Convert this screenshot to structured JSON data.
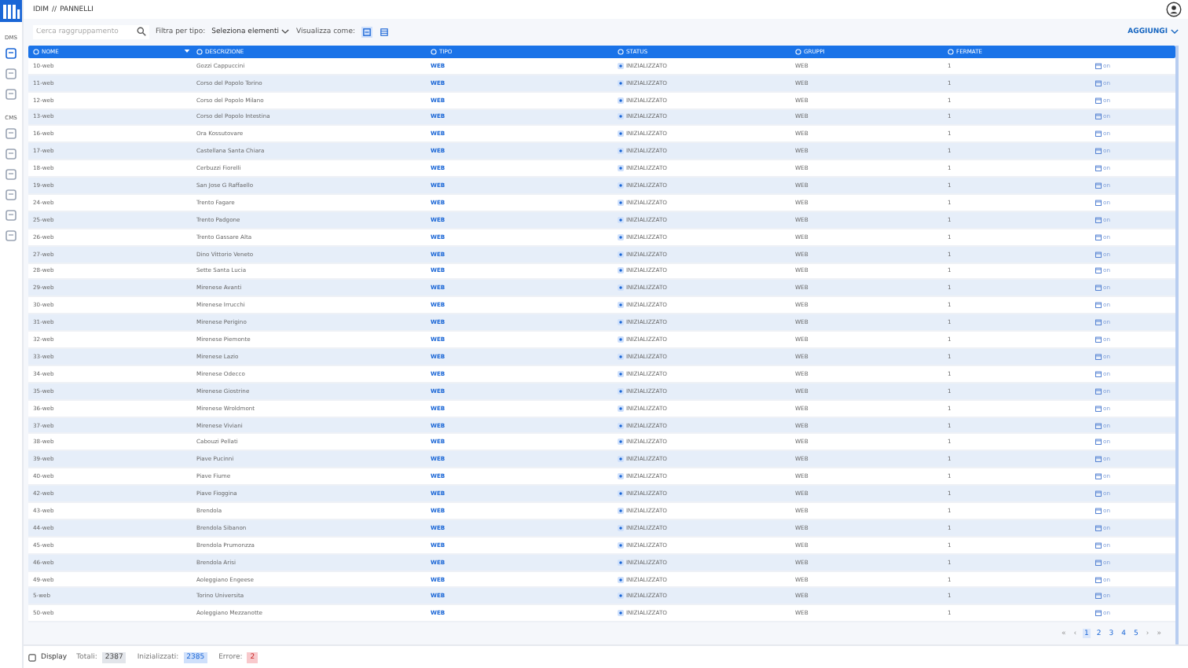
{
  "breadcrumb": [
    "IDIM",
    "//",
    "PANNELLI"
  ],
  "sidebar": {
    "sections": [
      {
        "label": "DMS",
        "items": [
          {
            "selected": true
          },
          {
            "selected": false
          },
          {
            "selected": false
          }
        ]
      },
      {
        "label": "CMS",
        "items": [
          {
            "selected": false
          },
          {
            "selected": false
          },
          {
            "selected": false
          },
          {
            "selected": false
          },
          {
            "selected": false
          },
          {
            "selected": false
          }
        ]
      }
    ]
  },
  "toolbar": {
    "search": {
      "placeholder": "Cerca raggruppamento"
    },
    "filter_label": "Filtra per tipo:",
    "filter_value": "Seleziona elementi",
    "view_label": "Visualizza come:",
    "views": [
      {
        "kind": "grid",
        "selected": true
      },
      {
        "kind": "list",
        "selected": false
      }
    ],
    "add_button": "AGGIUNGI"
  },
  "table": {
    "columns": [
      "NOME",
      "DESCRIZIONE",
      "TIPO",
      "STATUS",
      "GRUPPI",
      "FERMATE"
    ],
    "rows": [
      [
        "10-web",
        "Gozzi Cappuccini",
        "WEB",
        "INIZIALIZZATO",
        "WEB",
        "1",
        "on"
      ],
      [
        "11-web",
        "Corso del Popolo Torino",
        "WEB",
        "INIZIALIZZATO",
        "WEB",
        "1",
        "on"
      ],
      [
        "12-web",
        "Corso del Popolo Milano",
        "WEB",
        "INIZIALIZZATO",
        "WEB",
        "1",
        "on"
      ],
      [
        "13-web",
        "Corso del Popolo Intestina",
        "WEB",
        "INIZIALIZZATO",
        "WEB",
        "1",
        "on"
      ],
      [
        "16-web",
        "Ora Kossutovare",
        "WEB",
        "INIZIALIZZATO",
        "WEB",
        "1",
        "on"
      ],
      [
        "17-web",
        "Castellana Santa Chiara",
        "WEB",
        "INIZIALIZZATO",
        "WEB",
        "1",
        "on"
      ],
      [
        "18-web",
        "Cerbuzzi Fiorelli",
        "WEB",
        "INIZIALIZZATO",
        "WEB",
        "1",
        "on"
      ],
      [
        "19-web",
        "San Jose G Raffaello",
        "WEB",
        "INIZIALIZZATO",
        "WEB",
        "1",
        "on"
      ],
      [
        "24-web",
        "Trento Fagare",
        "WEB",
        "INIZIALIZZATO",
        "WEB",
        "1",
        "on"
      ],
      [
        "25-web",
        "Trento Padgone",
        "WEB",
        "INIZIALIZZATO",
        "WEB",
        "1",
        "on"
      ],
      [
        "26-web",
        "Trento Gassare Alta",
        "WEB",
        "INIZIALIZZATO",
        "WEB",
        "1",
        "on"
      ],
      [
        "27-web",
        "Dino Vittorio Veneto",
        "WEB",
        "INIZIALIZZATO",
        "WEB",
        "1",
        "on"
      ],
      [
        "28-web",
        "Sette Santa Lucia",
        "WEB",
        "INIZIALIZZATO",
        "WEB",
        "1",
        "on"
      ],
      [
        "29-web",
        "Mirenese Avanti",
        "WEB",
        "INIZIALIZZATO",
        "WEB",
        "1",
        "on"
      ],
      [
        "30-web",
        "Mirenese Irrucchi",
        "WEB",
        "INIZIALIZZATO",
        "WEB",
        "1",
        "on"
      ],
      [
        "31-web",
        "Mirenese Perigino",
        "WEB",
        "INIZIALIZZATO",
        "WEB",
        "1",
        "on"
      ],
      [
        "32-web",
        "Mirenese Piemonte",
        "WEB",
        "INIZIALIZZATO",
        "WEB",
        "1",
        "on"
      ],
      [
        "33-web",
        "Mirenese Lazio",
        "WEB",
        "INIZIALIZZATO",
        "WEB",
        "1",
        "on"
      ],
      [
        "34-web",
        "Mirenese Odecco",
        "WEB",
        "INIZIALIZZATO",
        "WEB",
        "1",
        "on"
      ],
      [
        "35-web",
        "Mirenese Giostrine",
        "WEB",
        "INIZIALIZZATO",
        "WEB",
        "1",
        "on"
      ],
      [
        "36-web",
        "Mirenese Wroldmont",
        "WEB",
        "INIZIALIZZATO",
        "WEB",
        "1",
        "on"
      ],
      [
        "37-web",
        "Mirenese Viviani",
        "WEB",
        "INIZIALIZZATO",
        "WEB",
        "1",
        "on"
      ],
      [
        "38-web",
        "Cabouzi Pellati",
        "WEB",
        "INIZIALIZZATO",
        "WEB",
        "1",
        "on"
      ],
      [
        "39-web",
        "Piave Pucinni",
        "WEB",
        "INIZIALIZZATO",
        "WEB",
        "1",
        "on"
      ],
      [
        "40-web",
        "Piave Fiume",
        "WEB",
        "INIZIALIZZATO",
        "WEB",
        "1",
        "on"
      ],
      [
        "42-web",
        "Piave Fioggina",
        "WEB",
        "INIZIALIZZATO",
        "WEB",
        "1",
        "on"
      ],
      [
        "43-web",
        "Brendola",
        "WEB",
        "INIZIALIZZATO",
        "WEB",
        "1",
        "on"
      ],
      [
        "44-web",
        "Brendola Sibanon",
        "WEB",
        "INIZIALIZZATO",
        "WEB",
        "1",
        "on"
      ],
      [
        "45-web",
        "Brendola Prumonzza",
        "WEB",
        "INIZIALIZZATO",
        "WEB",
        "1",
        "on"
      ],
      [
        "46-web",
        "Brendola Arisi",
        "WEB",
        "INIZIALIZZATO",
        "WEB",
        "1",
        "on"
      ],
      [
        "49-web",
        "Aoleggiano Engeese",
        "WEB",
        "INIZIALIZZATO",
        "WEB",
        "1",
        "on"
      ],
      [
        "5-web",
        "Torino Universita",
        "WEB",
        "INIZIALIZZATO",
        "WEB",
        "1",
        "on"
      ],
      [
        "50-web",
        "Aoleggiano Mezzanotte",
        "WEB",
        "INIZIALIZZATO",
        "WEB",
        "1",
        "on"
      ]
    ]
  },
  "pagination": {
    "first": "«",
    "prev": "‹",
    "pages": [
      {
        "label": "1",
        "selected": true
      },
      {
        "label": "2",
        "selected": false
      },
      {
        "label": "3",
        "selected": false
      },
      {
        "label": "4",
        "selected": false
      },
      {
        "label": "5",
        "selected": false
      }
    ],
    "next": "›",
    "last": "»"
  },
  "footer": {
    "label": "Display",
    "stats": [
      {
        "label": "Totali:",
        "value": "2387",
        "kind": "neutral"
      },
      {
        "label": "Inizializzati:",
        "value": "2385",
        "kind": "info"
      },
      {
        "label": "Errore:",
        "value": "2",
        "kind": "error"
      }
    ]
  }
}
